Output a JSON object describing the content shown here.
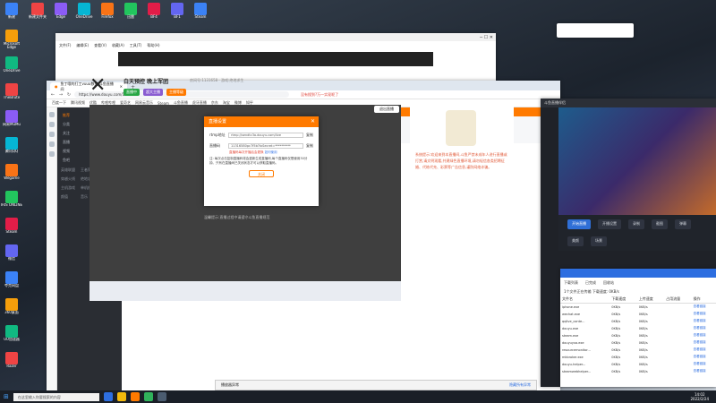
{
  "desktop": {
    "left_icons": [
      "新建",
      "Microsoft Edge",
      "OneDrive",
      "TheBrute",
      "网易MuMu",
      "腾讯QQ",
      "Wegame",
      "IRIS ONLINE",
      "Steam",
      "微信",
      "夸克网盘",
      "360桌面",
      "UU加速器",
      "Razer",
      "Proxifier",
      "YY语音",
      "ToDesk",
      "向日葵",
      "Google Chrome",
      "Thunder",
      "OBS Studio",
      "Bilibili",
      "阿里云盘",
      "百度网盘",
      "QQ音乐",
      "WeChat",
      "Shadowsocks",
      "斗鱼直播伴侣"
    ],
    "top_icons": [
      "新建文件夹",
      "Edge",
      "OneDrive",
      "Firefox",
      "迅雷",
      "BF4",
      "BF1",
      "Steam"
    ]
  },
  "explorer": {
    "menu": [
      "文件(F)",
      "编辑(E)",
      "查看(V)",
      "收藏(A)",
      "工具(T)",
      "帮助(H)"
    ]
  },
  "browser": {
    "tab_title": "鱼丁哦的打工vuuu数据-斗鱼直播间",
    "url": "https://www.douyu.com/1131658",
    "news_prompt": "没有搜到?万一实现呢了",
    "bookmarks": [
      "百度一下",
      "腾讯视频",
      "优酷",
      "哔哩哔哩",
      "爱奇艺",
      "网易云音乐",
      "Steam",
      "斗鱼直播",
      "虎牙直播",
      "京东",
      "淘宝",
      "微博",
      "知乎"
    ],
    "left_nav": [
      "推荐",
      "分类",
      "关注",
      "直播",
      "视频",
      "鱼吧"
    ],
    "left_grid": [
      "英雄联盟",
      "王者荣耀",
      "和平精英",
      "穿越火线",
      "绝地求生",
      "DOTA2",
      "主机游戏",
      "单机热游",
      "户外",
      "颜值",
      "音乐",
      "二次元"
    ],
    "header_links": [
      "首页",
      "直播",
      "分类",
      "视频",
      "鱼吧",
      "赛事",
      "活动"
    ],
    "categories": [
      "热门",
      "游戏",
      "娱乐",
      "科技",
      "体育",
      "颜值",
      "户外",
      "知识",
      "二次元",
      "音乐",
      "美食",
      "电竞"
    ],
    "room_title": "白天预控 晚上军团",
    "room_meta": "房间号:1131658 · 游戏:绝地求生",
    "room_tags": [
      "直播中",
      "超大主播",
      "主播等级"
    ],
    "chat_text": "系统提示:欢迎来到本直播间,斗鱼严禁未成年人进行直播或打赏,请文明观看,共建绿色直播环境,请勿轻信各类招聘征婚、代练代充、彩票等广告信息,谨防网络诈骗。"
  },
  "modal": {
    "title": "直播设置",
    "overlay_button": "退出直播",
    "rtmp_label": "rtmp地址",
    "rtmp_value": "rtmp://sendtc3a.douyu.com/live",
    "copy_label": "复制",
    "code_label": "直播码",
    "code_value": "11316580pc7f5b?txSecret=**********",
    "warn": "直播码每次开播后会更换",
    "warn_link": "如何使用",
    "note": "注: 每次点击复制直播码将会重新生成直播码,每个直播码仅限使用30分钟。只有在直播间已关闭状态才可以获取直播码。",
    "ok": "关闭",
    "footer": "温馨提示:直播过程中请遵守斗鱼直播规范"
  },
  "rightapp": {
    "title": "斗鱼直播伴侣",
    "actions": [
      "开始直播",
      "开播设置",
      "录制",
      "截图",
      "弹幕",
      "美颜",
      "场景"
    ]
  },
  "dlmgr": {
    "tabs": [
      "下载列表",
      "已完成",
      "回收站"
    ],
    "summary": "1个文件正在传输 下载速度: 0KB/s",
    "columns": [
      "文件名",
      "下载速度",
      "上传速度",
      "占用流量",
      "操作"
    ],
    "rows": [
      [
        "iphone.exe",
        "0KB/s",
        "0KB/s",
        "",
        "查看链接"
      ],
      [
        "wechat.exe",
        "0KB/s",
        "0KB/s",
        "",
        "查看链接"
      ],
      [
        "qqlive_conte...",
        "0KB/s",
        "0KB/s",
        "",
        "查看链接"
      ],
      [
        "douyu.exe",
        "0KB/s",
        "0KB/s",
        "",
        "查看链接"
      ],
      [
        "steam.exe",
        "0KB/s",
        "0KB/s",
        "",
        "查看链接"
      ],
      [
        "douyuyxa.exe",
        "0KB/s",
        "0KB/s",
        "",
        "查看链接"
      ],
      [
        "resourcemonitor...",
        "0KB/s",
        "0KB/s",
        "",
        "查看链接"
      ],
      [
        "mkbroker.exe",
        "0KB/s",
        "0KB/s",
        "",
        "查看链接"
      ],
      [
        "douyu-helper...",
        "0KB/s",
        "0KB/s",
        "",
        "查看链接"
      ],
      [
        "steamwebhelper...",
        "0KB/s",
        "0KB/s",
        "",
        "查看链接"
      ]
    ]
  },
  "taskbar": {
    "search_placeholder": "在这里输入你要搜索的内容",
    "time": "14:02",
    "date": "2022/2/24"
  },
  "notify": {
    "text": "播放器异常",
    "link": "隐藏所有异常"
  },
  "colors": {
    "accent": "#ff7a00",
    "link": "#2d6ee0",
    "warn": "#e24a3b"
  }
}
